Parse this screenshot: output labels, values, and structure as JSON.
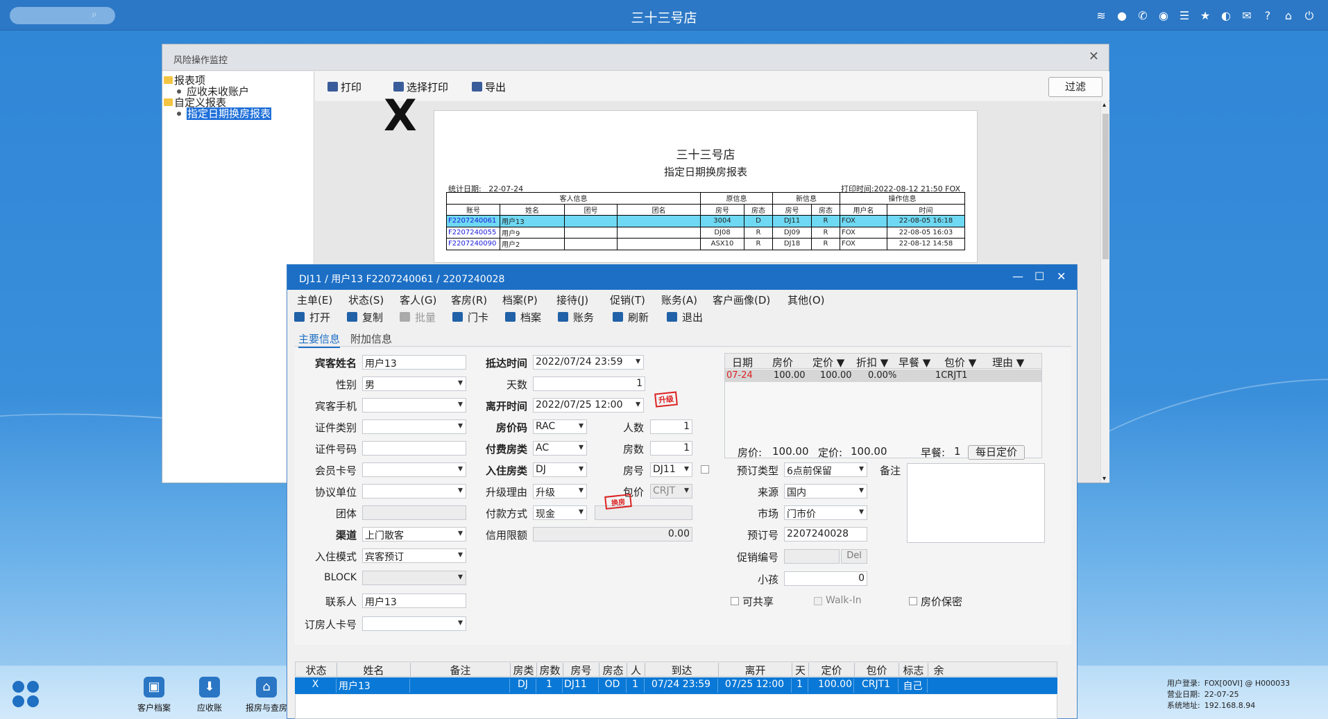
{
  "topbar": {
    "title": "三十三号店",
    "search_icon": "search-icon",
    "icons": [
      "wifi-icon",
      "chat-icon",
      "phone-icon",
      "palette-icon",
      "menu-icon",
      "star-icon",
      "theme-icon",
      "mail-icon",
      "help-icon",
      "home-icon",
      "power-icon"
    ]
  },
  "taskbar": {
    "items": [
      {
        "label": "客户档案",
        "icon": "customer-file-icon"
      },
      {
        "label": "应收账",
        "icon": "receivable-icon"
      },
      {
        "label": "报房与查房",
        "icon": "room-report-icon"
      }
    ],
    "sysinfo": {
      "user_label": "用户登录:",
      "user_value": "FOX[00VI] @ H000033",
      "date_label": "营业日期:",
      "date_value": "22-07-25",
      "addr_label": "系统地址:",
      "addr_value": "192.168.8.94"
    }
  },
  "report_window": {
    "title": "风险操作监控",
    "tree": [
      {
        "label": "报表项",
        "type": "folder"
      },
      {
        "label": "应收未收账户",
        "type": "leaf"
      },
      {
        "label": "自定义报表",
        "type": "folder"
      },
      {
        "label": "指定日期换房报表",
        "type": "leaf",
        "selected": true
      }
    ],
    "toolbar": {
      "print": "打印",
      "select_print": "选择打印",
      "export": "导出",
      "filter": "过滤"
    },
    "paper": {
      "title": "三十三号店",
      "subtitle": "指定日期换房报表",
      "stat_date_label": "统计日期:",
      "stat_date": "22-07-24",
      "print_time_label": "打印时间:",
      "print_time": "2022-08-12 21:50 FOX",
      "group_headers": [
        "客人信息",
        "原信息",
        "新信息",
        "操作信息"
      ],
      "columns": [
        "账号",
        "姓名",
        "团号",
        "团名",
        "房号",
        "房态",
        "房号",
        "房态",
        "用户名",
        "时间"
      ],
      "rows": [
        [
          "F2207240061",
          "用户13",
          "",
          "",
          "3004",
          "D",
          "DJ11",
          "R",
          "FOX",
          "22-08-05 16:18"
        ],
        [
          "F2207240055",
          "用户9",
          "",
          "",
          "DJ08",
          "R",
          "DJ09",
          "R",
          "FOX",
          "22-08-05 16:03"
        ],
        [
          "F2207240090",
          "用户2",
          "",
          "",
          "ASX10",
          "R",
          "DJ18",
          "R",
          "FOX",
          "22-08-12 14:58"
        ]
      ]
    }
  },
  "dialog": {
    "title": "DJ11 / 用户13 F2207240061 / 2207240028",
    "menu": [
      "主单(E)",
      "状态(S)",
      "客人(G)",
      "客房(R)",
      "档案(P)",
      "接待(J)",
      "促销(T)",
      "账务(A)",
      "客户画像(D)",
      "其他(O)"
    ],
    "toolbar": [
      {
        "label": "打开"
      },
      {
        "label": "复制"
      },
      {
        "label": "批量"
      },
      {
        "label": "门卡"
      },
      {
        "label": "档案"
      },
      {
        "label": "账务"
      },
      {
        "label": "刷新"
      },
      {
        "label": "退出"
      }
    ],
    "tabs": [
      "主要信息",
      "附加信息"
    ],
    "form": {
      "guest_name_label": "宾客姓名",
      "guest_name": "用户13",
      "gender_label": "性别",
      "gender": "男",
      "mobile_label": "宾客手机",
      "mobile": "",
      "id_type_label": "证件类别",
      "id_type": "",
      "id_no_label": "证件号码",
      "id_no": "",
      "member_label": "会员卡号",
      "member": "",
      "agreement_label": "协议单位",
      "agreement": "",
      "group_label": "团体",
      "group": "",
      "channel_label": "渠道",
      "channel": "上门散客",
      "checkin_mode_label": "入住模式",
      "checkin_mode": "宾客预订",
      "block_label": "BLOCK",
      "block": "",
      "contact_label": "联系人",
      "contact": "用户13",
      "booker_card_label": "订房人卡号",
      "booker_card": "",
      "arrival_label": "抵达时间",
      "arrival": "2022/07/24 23:59",
      "days_label": "天数",
      "days": "1",
      "depart_label": "离开时间",
      "depart": "2022/07/25 12:00",
      "rate_code_label": "房价码",
      "rate_code": "RAC",
      "persons_label": "人数",
      "persons": "1",
      "pay_type_label": "付费房类",
      "pay_type": "AC",
      "rooms_label": "房数",
      "rooms": "1",
      "room_type_label": "入住房类",
      "room_type": "DJ",
      "room_no_label": "房号",
      "room_no": "DJ11",
      "upgrade_label": "升级理由",
      "upgrade": "升级",
      "package_label": "包价",
      "package": "CRJT",
      "pay_method_label": "付款方式",
      "pay_method": "现金",
      "credit_label": "信用限额",
      "credit": "0.00",
      "stamp_upgrade": "升级",
      "stamp_change": "换房",
      "big_mark": "X",
      "booking_type_label": "预订类型",
      "booking_type": "6点前保留",
      "remark_label": "备注",
      "source_label": "来源",
      "source": "国内",
      "market_label": "市场",
      "market": "门市价",
      "booking_no_label": "预订号",
      "booking_no": "2207240028",
      "promo_label": "促销编号",
      "promo": "",
      "del_btn": "Del",
      "child_label": "小孩",
      "child": "0",
      "shareable_label": "可共享",
      "walkin_label": "Walk-In",
      "rate_secret_label": "房价保密"
    },
    "rate_panel": {
      "headers": [
        "日期",
        "房价",
        "定价 ▼",
        "折扣 ▼",
        "早餐 ▼",
        "包价 ▼",
        "理由 ▼"
      ],
      "row": [
        "07-24",
        "100.00",
        "100.00",
        "0.00%",
        "1CRJT1",
        ""
      ],
      "sum_rate_label": "房价:",
      "sum_rate": "100.00",
      "sum_fixed_label": "定价:",
      "sum_fixed": "100.00",
      "sum_bf_label": "早餐:",
      "sum_bf": "1",
      "daily_btn": "每日定价"
    },
    "grid": {
      "columns": [
        "状态",
        "姓名",
        "备注",
        "房类",
        "房数",
        "房号",
        "房态",
        "人",
        "到达",
        "离开",
        "天",
        "定价",
        "包价",
        "标志",
        "余"
      ],
      "row": [
        "X",
        "用户13",
        "",
        "DJ",
        "1",
        "DJ11",
        "OD",
        "1",
        "07/24 23:59",
        "07/25 12:00",
        "1",
        "100.00",
        "CRJT1",
        "自己",
        ""
      ]
    }
  }
}
